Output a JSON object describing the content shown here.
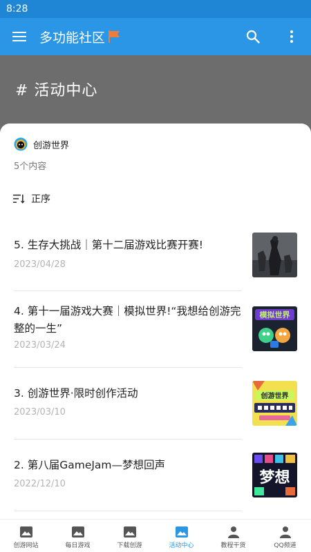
{
  "status_bar": {
    "time": "8:28"
  },
  "app_bar": {
    "title": "多功能社区",
    "menu_icon": "menu-icon",
    "search_icon": "search-icon",
    "more_icon": "more-vert-icon"
  },
  "banner": {
    "title": "# 活动中心"
  },
  "source": {
    "name": "创游世界",
    "count": "5个内容"
  },
  "sort": {
    "label": "正序"
  },
  "articles": [
    {
      "title": "5. 生存大挑战｜第十二届游戏比赛开赛!",
      "date": "2023/04/28"
    },
    {
      "title": "4. 第十一届游戏大赛｜模拟世界!“我想给创游完整的一生”",
      "date": "2023/03/24"
    },
    {
      "title": "3. 创游世界·限时创作活动",
      "date": "2023/03/10"
    },
    {
      "title": "2. 第八届GameJam—梦想回声",
      "date": "2022/12/10"
    }
  ],
  "thumbs": [
    {
      "text": ""
    },
    {
      "text": "模拟世界"
    },
    {
      "text": "创游世界"
    },
    {
      "text": "梦想"
    }
  ],
  "bottom_nav": [
    {
      "label": "创游网站",
      "icon": "image-icon",
      "active": false
    },
    {
      "label": "每日游戏",
      "icon": "image-icon",
      "active": false
    },
    {
      "label": "下载创游",
      "icon": "image-icon",
      "active": false
    },
    {
      "label": "活动中心",
      "icon": "image-icon",
      "active": true
    },
    {
      "label": "教程干货",
      "icon": "person-icon",
      "active": false
    },
    {
      "label": "QQ频道",
      "icon": "person-icon",
      "active": false
    }
  ],
  "colors": {
    "primary": "#2a96e5",
    "status_bar": "#1f86d6",
    "banner": "#6d6d6d",
    "date": "#b3b3b3",
    "flag": "#f07c3c"
  }
}
